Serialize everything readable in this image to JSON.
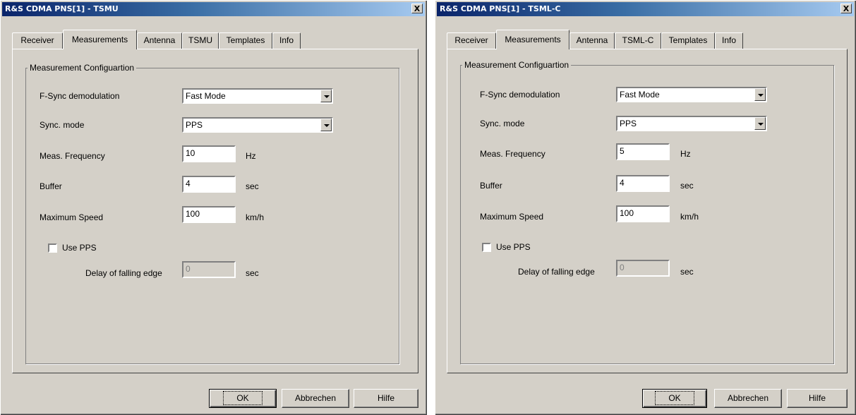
{
  "dialogs": [
    {
      "title": "R&S CDMA PNS[1] - TSMU",
      "close_label": "X",
      "tabs": [
        "Receiver",
        "Measurements",
        "Antenna",
        "TSMU",
        "Templates",
        "Info"
      ],
      "group_title": "Measurement Configuartion",
      "fsync_label": "F-Sync demodulation",
      "fsync_value": "Fast Mode",
      "sync_label": "Sync. mode",
      "sync_value": "PPS",
      "freq_label": "Meas. Frequency",
      "freq_value": "10",
      "freq_unit": "Hz",
      "buffer_label": "Buffer",
      "buffer_value": "4",
      "buffer_unit": "sec",
      "speed_label": "Maximum Speed",
      "speed_value": "100",
      "speed_unit": "km/h",
      "use_pps_label": "Use PPS",
      "delay_label": "Delay of falling edge",
      "delay_value": "0",
      "delay_unit": "sec",
      "buttons": [
        "OK",
        "Abbrechen",
        "Hilfe"
      ]
    },
    {
      "title": "R&S CDMA PNS[1] - TSML-C",
      "close_label": "X",
      "tabs": [
        "Receiver",
        "Measurements",
        "Antenna",
        "TSML-C",
        "Templates",
        "Info"
      ],
      "group_title": "Measurement Configuartion",
      "fsync_label": "F-Sync demodulation",
      "fsync_value": "Fast Mode",
      "sync_label": "Sync. mode",
      "sync_value": "PPS",
      "freq_label": "Meas. Frequency",
      "freq_value": "5",
      "freq_unit": "Hz",
      "buffer_label": "Buffer",
      "buffer_value": "4",
      "buffer_unit": "sec",
      "speed_label": "Maximum Speed",
      "speed_value": "100",
      "speed_unit": "km/h",
      "use_pps_label": "Use PPS",
      "delay_label": "Delay of falling edge",
      "delay_value": "0",
      "delay_unit": "sec",
      "buttons": [
        "OK",
        "Abbrechen",
        "Hilfe"
      ]
    }
  ],
  "active_tab": "Measurements",
  "colors": {
    "title_start": "#0a246a",
    "title_end": "#a6caf0",
    "face": "#d4d0c8"
  }
}
